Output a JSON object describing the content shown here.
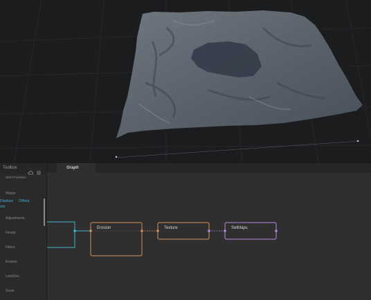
{
  "sidebar": {
    "title": "Toolbox",
    "subtitle": "Sets Primitives",
    "warps_label": "Warps",
    "sub_item_a": "Displace",
    "sub_item_b": "DWarp",
    "sub_item_c": "arp",
    "items": [
      "Adjustments",
      "Fluvial",
      "Filters",
      "Erosion",
      "LookDev",
      "Snow"
    ]
  },
  "graph": {
    "tab_label": "Graph",
    "nodes": {
      "erosion": "Erosion",
      "texture": "Texture",
      "setmaps": "SetMaps"
    }
  },
  "colors": {
    "erosion_node": "#d9935a",
    "texture_node": "#d9935a",
    "setmaps_node": "#b58ad9",
    "input_node": "#3fb4c6"
  },
  "icons": [
    "cloud-icon",
    "menu-icon"
  ]
}
